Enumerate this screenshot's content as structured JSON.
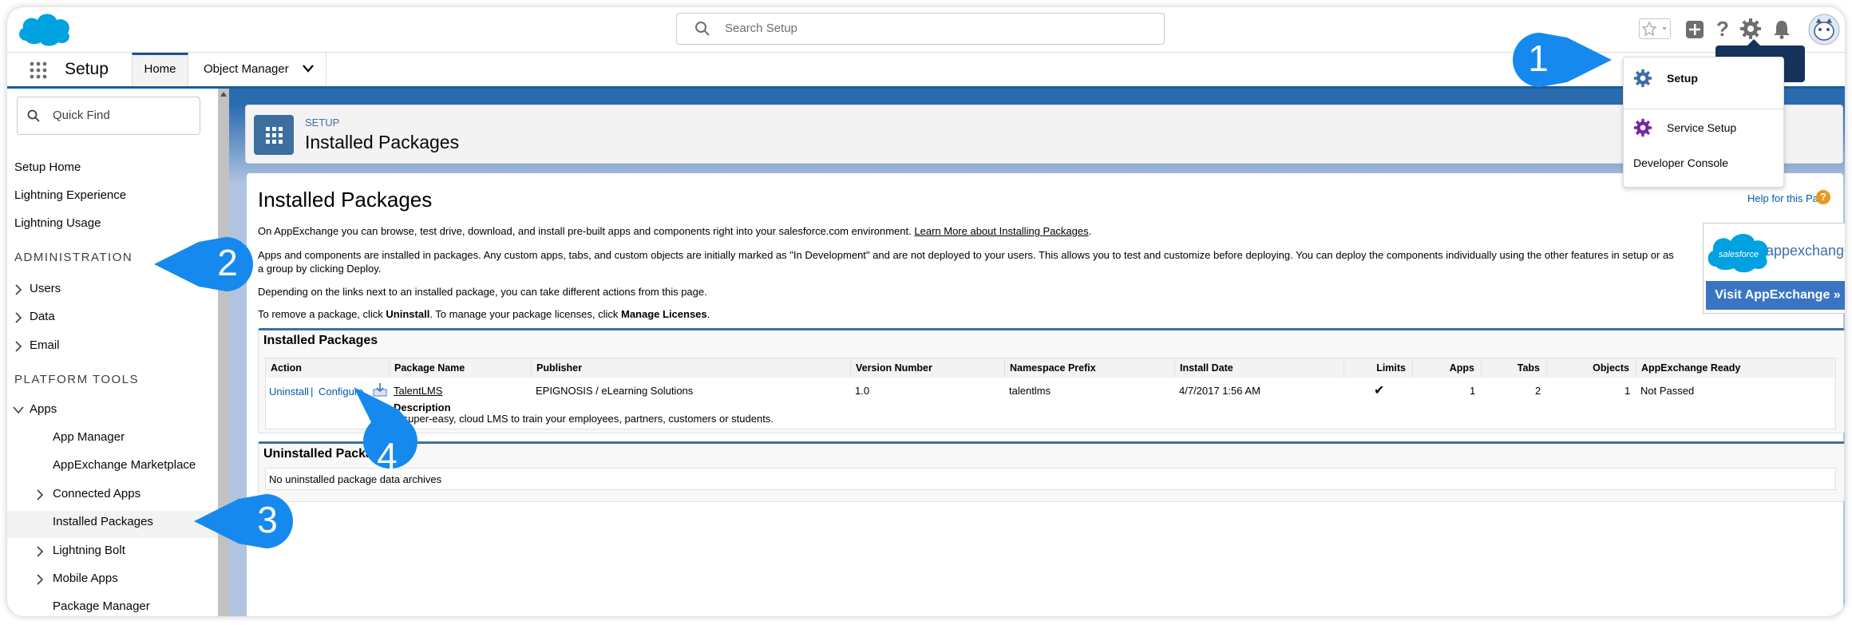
{
  "header": {
    "search_placeholder": "Search Setup"
  },
  "nav": {
    "app_name": "Setup",
    "tabs": [
      {
        "label": "Home"
      },
      {
        "label": "Object Manager"
      }
    ]
  },
  "sidebar": {
    "quick_find_placeholder": "Quick Find",
    "top_items": [
      "Setup Home",
      "Lightning Experience",
      "Lightning Usage"
    ],
    "admin_heading": "ADMINISTRATION",
    "admin_items": [
      "Users",
      "Data",
      "Email"
    ],
    "platform_heading": "PLATFORM TOOLS",
    "apps_label": "Apps",
    "apps_children": [
      "App Manager",
      "AppExchange Marketplace",
      "Connected Apps",
      "Installed Packages",
      "Lightning Bolt",
      "Mobile Apps",
      "Package Manager"
    ]
  },
  "page_header": {
    "breadcrumb": "SETUP",
    "title": "Installed Packages"
  },
  "content": {
    "title": "Installed Packages",
    "help_link": "Help for this Page",
    "help_icon": "?",
    "para1_text": "On AppExchange you can browse, test drive, download, and install pre-built apps and components right into your salesforce.com environment.",
    "para1_link": "Learn More about Installing Packages",
    "para2": "Apps and components are installed in packages. Any custom apps, tabs, and custom objects are initially marked as \"In Development\" and are not deployed to your users. This allows you to test and customize before deploying. You can deploy the components individually using the other features in setup or as a group by clicking Deploy.",
    "para3": "Depending on the links next to an installed package, you can take different actions from this page.",
    "para4_a": "To remove a package, click ",
    "para4_b": "Uninstall",
    "para4_c": ". To manage your package licenses, click ",
    "para4_d": "Manage Licenses",
    "para4_e": ".",
    "appexchange": {
      "logo_text": "salesforce",
      "brand": "appexchange",
      "button": "Visit AppExchange »"
    }
  },
  "installed": {
    "title": "Installed Packages",
    "columns": [
      "Action",
      "Package Name",
      "Publisher",
      "Version Number",
      "Namespace Prefix",
      "Install Date",
      "Limits",
      "Apps",
      "Tabs",
      "Objects",
      "AppExchange Ready"
    ],
    "row": {
      "uninstall": "Uninstall",
      "sep": "|",
      "configure": "Configure",
      "package_name": "TalentLMS",
      "publisher": "EPIGNOSIS / eLearning Solutions",
      "version": "1.0",
      "namespace": "talentlms",
      "install_date": "4/7/2017 1:56 AM",
      "limits": "✔",
      "apps": "1",
      "tabs": "2",
      "objects": "1",
      "appexchange_ready": "Not Passed",
      "description_label": "Description",
      "description": "A super-easy, cloud LMS to train your employees, partners, customers or students."
    }
  },
  "uninstalled": {
    "title": "Uninstalled Packages",
    "message": "No uninstalled package data archives"
  },
  "gear_menu": {
    "tooltip": "Setup",
    "items": [
      "Setup",
      "Service Setup",
      "Developer Console"
    ]
  },
  "callouts": [
    "1",
    "2",
    "3",
    "4"
  ],
  "colors": {
    "callout": "#1589ee",
    "brand_blue": "#1b5297",
    "link": "#015ba7"
  }
}
